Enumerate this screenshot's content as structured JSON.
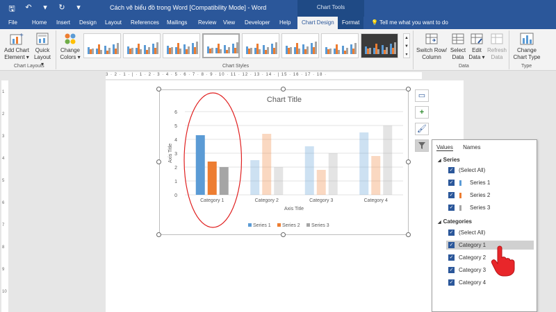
{
  "titlebar": {
    "document_title": "Cách vẽ biểu đồ trong Word [Compatibility Mode] - Word",
    "context_group": "Chart Tools"
  },
  "tabs": [
    "File",
    "Home",
    "Insert",
    "Design",
    "Layout",
    "References",
    "Mailings",
    "Review",
    "View",
    "Developer",
    "Help"
  ],
  "active_tab": "Chart Design",
  "format_tab": "Format",
  "tell_me": "Tell me what you want to do",
  "ribbon": {
    "add_chart_element": [
      "Add Chart",
      "Element ▾"
    ],
    "quick_layout": [
      "Quick",
      "Layout ▾"
    ],
    "change_colors": [
      "Change",
      "Colors ▾"
    ],
    "chart_layouts_label": "Chart Layouts",
    "chart_styles_label": "Chart Styles",
    "switch_row_column": [
      "Switch Row/",
      "Column"
    ],
    "select_data": [
      "Select",
      "Data"
    ],
    "edit_data": [
      "Edit",
      "Data ▾"
    ],
    "refresh_data": [
      "Refresh",
      "Data"
    ],
    "data_label": "Data",
    "change_chart_type": [
      "Change",
      "Chart Type"
    ],
    "type_label": "Type"
  },
  "ruler_text": "3 · 2 · 1 · | · 1 · 2 · 3 · 4 · 5 · 6 · 7 · 8 · 9 · 10 · 11 · 12 · 13 · 14 · | 15 · 16 · 17 · 18 ·",
  "vruler": [
    "1",
    "2",
    "3",
    "4",
    "5",
    "6",
    "7",
    "8",
    "9",
    "10"
  ],
  "colors": {
    "series1": "#5b9bd5",
    "series2": "#ed7d31",
    "series3": "#a5a5a5",
    "accent": "#2b579a",
    "annotation": "#e01f1f"
  },
  "chart_data": {
    "type": "bar",
    "title": "Chart Title",
    "xlabel": "Axis Title",
    "ylabel": "Axis Title",
    "categories": [
      "Category 1",
      "Category 2",
      "Category 3",
      "Category 4"
    ],
    "series": [
      {
        "name": "Series 1",
        "values": [
          4.3,
          2.5,
          3.5,
          4.5
        ]
      },
      {
        "name": "Series 2",
        "values": [
          2.4,
          4.4,
          1.8,
          2.8
        ]
      },
      {
        "name": "Series 3",
        "values": [
          2,
          2,
          3,
          5
        ]
      }
    ],
    "ylim": [
      0,
      6
    ],
    "yticks": [
      "0",
      "1",
      "2",
      "3",
      "4",
      "5",
      "6"
    ],
    "grid": true,
    "legend": "bottom",
    "highlighted_category": "Category 1"
  },
  "filter_pane": {
    "tabs": [
      "Values",
      "Names"
    ],
    "series_header": "Series",
    "series_items": [
      "(Select All)",
      "Series 1",
      "Series 2",
      "Series 3"
    ],
    "categories_header": "Categories",
    "category_items": [
      "(Select All)",
      "Category 1",
      "Category 2",
      "Category 3",
      "Category 4"
    ],
    "hovered_item": "Category 1"
  },
  "icons": {
    "side_buttons": [
      "chart-layout-icon",
      "plus-icon",
      "brush-icon",
      "filter-icon"
    ]
  }
}
